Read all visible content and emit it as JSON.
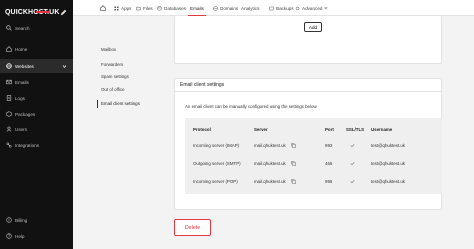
{
  "brand": {
    "name": "QUICKHOST",
    "suffix": ".UK"
  },
  "sidebar": {
    "items": [
      {
        "label": "Search",
        "icon": "search-icon"
      },
      {
        "label": "Home",
        "icon": "home-icon"
      },
      {
        "label": "Websites",
        "icon": "globe-icon"
      },
      {
        "label": "Emails",
        "icon": "mail-icon"
      },
      {
        "label": "Logs",
        "icon": "logs-icon"
      },
      {
        "label": "Packages",
        "icon": "package-icon"
      },
      {
        "label": "Users",
        "icon": "users-icon"
      },
      {
        "label": "Integrations",
        "icon": "integrations-icon"
      },
      {
        "label": "Billing",
        "icon": "billing-icon"
      },
      {
        "label": "Help",
        "icon": "help-icon"
      }
    ]
  },
  "topnav": {
    "items": [
      {
        "label": "Apps"
      },
      {
        "label": "Files"
      },
      {
        "label": "Databases"
      },
      {
        "label": "Emails"
      },
      {
        "label": "Domains"
      },
      {
        "label": "Analytics"
      },
      {
        "label": "Backups"
      },
      {
        "label": "Advanced"
      }
    ]
  },
  "submenu": {
    "items": [
      {
        "label": "Mailbox"
      },
      {
        "label": "Forwarders"
      },
      {
        "label": "Spam settings"
      },
      {
        "label": "Out of office"
      },
      {
        "label": "Email client settings"
      }
    ]
  },
  "add_button": "Add",
  "client_settings": {
    "title": "Email client settings",
    "description": "An email client can be manually configured using the settings below.",
    "headers": {
      "protocol": "Protocol",
      "server": "Server",
      "port": "Port",
      "ssl": "SSL/TLS",
      "username": "Username"
    },
    "rows": [
      {
        "protocol": "Incoming server (IMAP)",
        "server": "mail.qhuktest.uk",
        "port": "993",
        "username": "test@qhuktest.uk"
      },
      {
        "protocol": "Outgoing server (SMTP)",
        "server": "mail.qhuktest.uk",
        "port": "465",
        "username": "test@qhuktest.uk"
      },
      {
        "protocol": "Incoming server (POP)",
        "server": "mail.qhuktest.uk",
        "port": "995",
        "username": "test@qhuktest.uk"
      }
    ]
  },
  "delete_button": "Delete",
  "colors": {
    "accent": "#e5373f",
    "sidebar": "#111111"
  }
}
